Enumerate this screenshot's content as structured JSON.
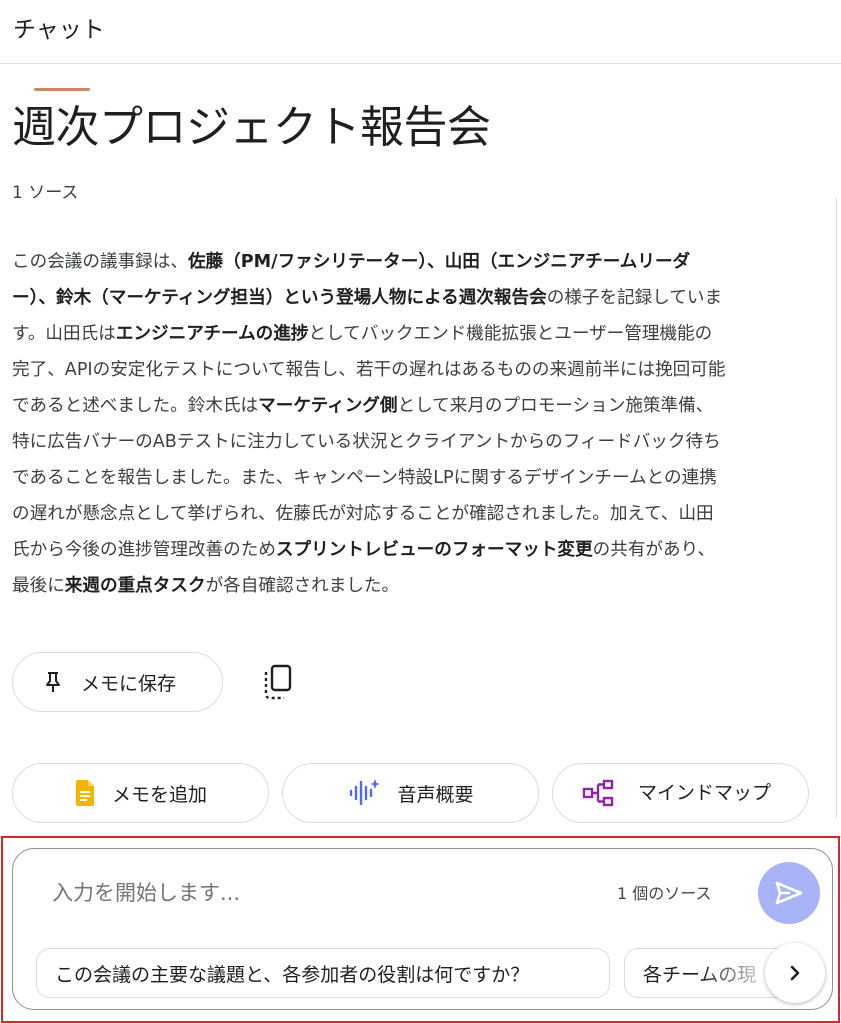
{
  "header": {
    "title": "チャット"
  },
  "notebook": {
    "title": "週次プロジェクト報告会",
    "source_count": "1 ソース",
    "summary_lines": [
      [
        {
          "t": "この会議の議事録は、"
        },
        {
          "t": "佐藤（PM/ファシリテーター）、山田（エンジニアチームリーダ",
          "b": true
        }
      ],
      [
        {
          "t": "ー）、鈴木（マーケティング担当）という登場人物による週次報告会",
          "b": true
        },
        {
          "t": "の様子を記録していま"
        }
      ],
      [
        {
          "t": "す。山田氏は"
        },
        {
          "t": "エンジニアチームの進捗",
          "b": true
        },
        {
          "t": "としてバックエンド機能拡張とユーザー管理機能の"
        }
      ],
      [
        {
          "t": "完了、APIの安定化テストについて報告し、若干の遅れはあるものの来週前半には挽回可能"
        }
      ],
      [
        {
          "t": "であると述べました。鈴木氏は"
        },
        {
          "t": "マーケティング側",
          "b": true
        },
        {
          "t": "として来月のプロモーション施策準備、"
        }
      ],
      [
        {
          "t": "特に広告バナーのABテストに注力している状況とクライアントからのフィードバック待ち"
        }
      ],
      [
        {
          "t": "であることを報告しました。また、キャンペーン特設LPに関するデザインチームとの連携"
        }
      ],
      [
        {
          "t": "の遅れが懸念点として挙げられ、佐藤氏が対応することが確認されました。加えて、山田"
        }
      ],
      [
        {
          "t": "氏から今後の進捗管理改善のため"
        },
        {
          "t": "スプリントレビューのフォーマット変更",
          "b": true
        },
        {
          "t": "の共有があり、"
        }
      ],
      [
        {
          "t": "最後に"
        },
        {
          "t": "来週の重点タスク",
          "b": true
        },
        {
          "t": "が各自確認されました。"
        }
      ]
    ]
  },
  "actions": {
    "save_memo": "メモに保存",
    "add_memo": "メモを追加",
    "audio_overview": "音声概要",
    "mind_map": "マインドマップ"
  },
  "composer": {
    "placeholder": "入力を開始します...",
    "source_chip": "1 個のソース",
    "suggestions": [
      "この会議の主要な議題と、各参加者の役割は何ですか？",
      "各チームの現"
    ]
  },
  "icons": {
    "pin": "pin-icon",
    "copy": "copy-icon",
    "note": "note-icon",
    "audio": "audio-wave-icon",
    "mindmap": "mindmap-icon",
    "send": "send-icon",
    "next": "chevron-right-icon"
  },
  "colors": {
    "note_icon": "#f4b400",
    "audio_icon": "#4f6bed",
    "mindmap_icon": "#8e24aa",
    "send_button": "#a8b2f6",
    "highlight": "#d6262a"
  }
}
